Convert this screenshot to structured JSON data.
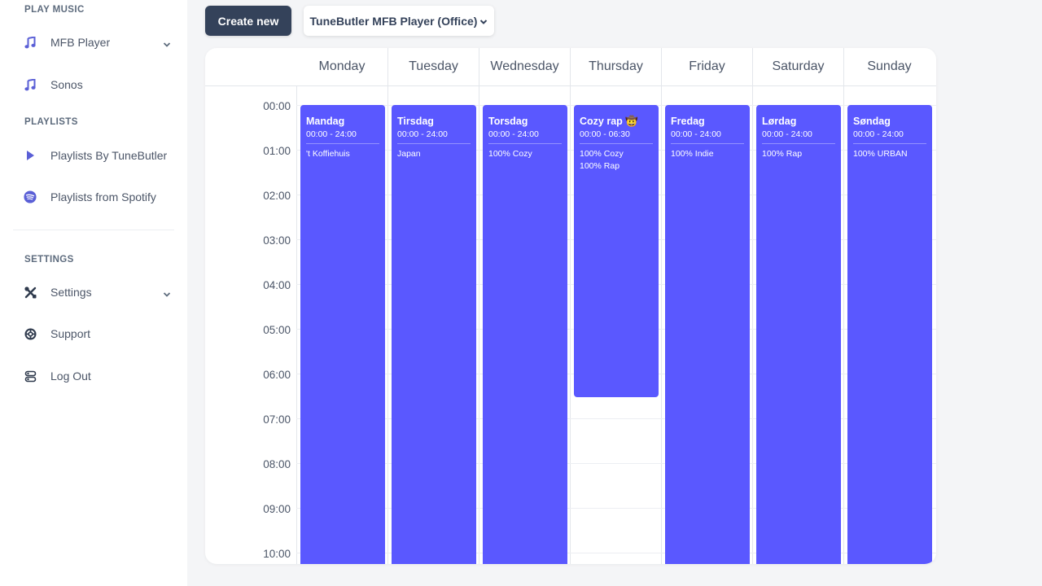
{
  "sidebar": {
    "play_music_title": "PLAY MUSIC",
    "mfb_player": "MFB Player",
    "sonos": "Sonos",
    "playlists_title": "PLAYLISTS",
    "playlists_tunebutler": "Playlists By TuneButler",
    "playlists_spotify": "Playlists from Spotify",
    "settings_title": "SETTINGS",
    "settings": "Settings",
    "support": "Support",
    "logout": "Log Out"
  },
  "toolbar": {
    "create_label": "Create new",
    "player_label": "TuneButler MFB Player (Office)"
  },
  "calendar": {
    "days": [
      "Monday",
      "Tuesday",
      "Wednesday",
      "Thursday",
      "Friday",
      "Saturday",
      "Sunday"
    ],
    "times": [
      "00:00",
      "01:00",
      "02:00",
      "03:00",
      "04:00",
      "05:00",
      "06:00",
      "07:00",
      "08:00",
      "09:00",
      "10:00"
    ],
    "events": [
      {
        "title": "Mandag",
        "time": "00:00 - 24:00",
        "items": [
          "'t Koffiehuis"
        ]
      },
      {
        "title": "Tirsdag",
        "time": "00:00 - 24:00",
        "items": [
          "Japan"
        ]
      },
      {
        "title": "Torsdag",
        "time": "00:00 - 24:00",
        "items": [
          "100% Cozy"
        ]
      },
      {
        "title": "Cozy rap 🤠",
        "time": "00:00 - 06:30",
        "items": [
          "100% Cozy",
          "100% Rap"
        ]
      },
      {
        "title": "Fredag",
        "time": "00:00 - 24:00",
        "items": [
          "100% Indie"
        ]
      },
      {
        "title": "Lørdag",
        "time": "00:00 - 24:00",
        "items": [
          "100% Rap"
        ]
      },
      {
        "title": "Søndag",
        "time": "00:00 - 24:00",
        "items": [
          "100% URBAN"
        ]
      }
    ]
  },
  "colors": {
    "event": "#5a58ff",
    "primary_button": "#34425a",
    "accent_icon": "#5a5fd6"
  },
  "icons": {
    "mfb_player": "music-note-icon",
    "sonos": "music-note-icon",
    "playlists_tunebutler": "play-icon",
    "playlists_spotify": "spotify-icon",
    "settings": "tools-icon",
    "support": "lifebuoy-icon",
    "logout": "logout-icon"
  }
}
